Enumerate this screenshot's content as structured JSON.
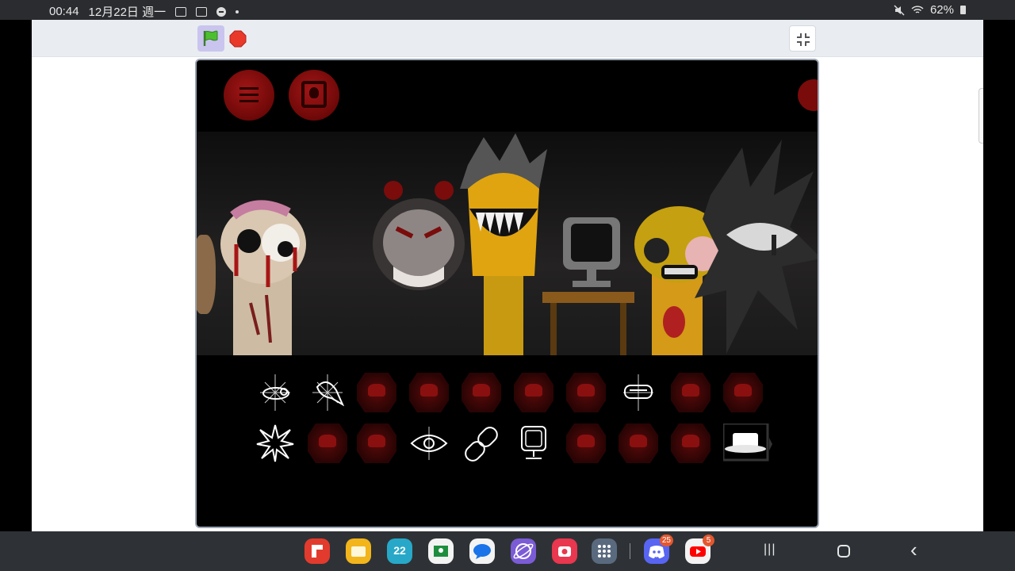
{
  "status_bar": {
    "time": "00:44",
    "date": "12月22日 週一",
    "battery": "62%"
  },
  "toolbar": {
    "green_flag": "green-flag-icon",
    "stop": "stop-sign-icon",
    "fullscreen_exit": "fullscreen-exit-icon"
  },
  "stage": {
    "top_buttons": [
      "menu-icon",
      "character-icon"
    ],
    "sound_icons_row1": [
      "spider-creature",
      "bleeding-head",
      "locked",
      "locked",
      "locked",
      "locked",
      "locked",
      "eye-mask",
      "locked",
      "locked"
    ],
    "sound_icons_row2": [
      "star-burst",
      "locked",
      "locked",
      "eye",
      "pills",
      "computer-monitor",
      "locked",
      "locked",
      "locked",
      "white-hat"
    ]
  },
  "taskbar": {
    "apps": [
      {
        "name": "flipboard",
        "color": "#e23b2e"
      },
      {
        "name": "files",
        "color": "#f2b51b"
      },
      {
        "name": "calendar",
        "color": "#27a8c8",
        "label": "22"
      },
      {
        "name": "classroom",
        "color": "#f3f3f3"
      },
      {
        "name": "messages",
        "color": "#f3f3f3"
      },
      {
        "name": "internet",
        "color": "#7b5cd6"
      },
      {
        "name": "camera",
        "color": "#e8374e"
      },
      {
        "name": "app-drawer",
        "color": "#5a6a7e"
      },
      {
        "name": "discord",
        "color": "#5865f2",
        "badge": "25"
      },
      {
        "name": "youtube",
        "color": "#f3f3f3",
        "badge": "5"
      }
    ],
    "nav_recent": "|||",
    "nav_back": "‹"
  }
}
